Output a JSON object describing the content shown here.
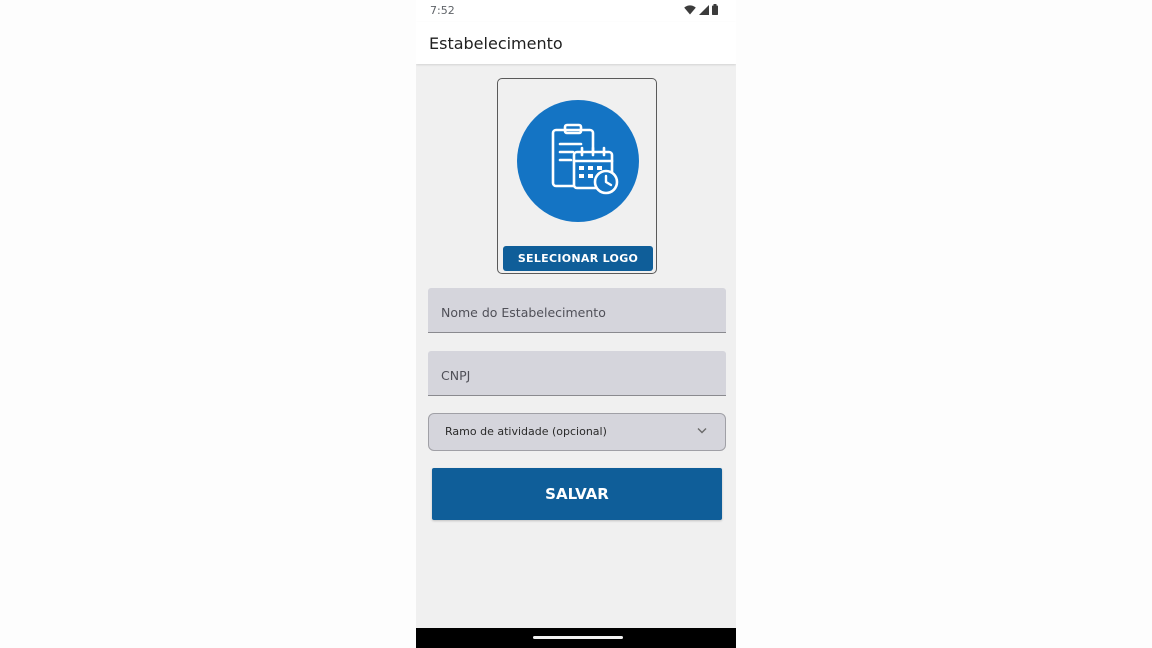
{
  "status_bar": {
    "time": "7:52",
    "icons": [
      "wifi-icon",
      "signal-icon",
      "battery-icon"
    ]
  },
  "app_bar": {
    "title": "Estabelecimento"
  },
  "logo_picker": {
    "icon": "clipboard-calendar-clock-icon",
    "button_label": "SELECIONAR LOGO"
  },
  "form": {
    "name_field": {
      "placeholder": "Nome do Estabelecimento",
      "value": ""
    },
    "cnpj_field": {
      "placeholder": "CNPJ",
      "value": ""
    },
    "activity_dropdown": {
      "selected": "Ramo de atividade (opcional)",
      "icon": "chevron-down-icon"
    },
    "save_label": "SALVAR"
  },
  "colors": {
    "primary": "#0f5e99",
    "logo_circle": "#1474c4",
    "field_background": "#d5d5dc",
    "screen_background": "#f0f0f0"
  }
}
